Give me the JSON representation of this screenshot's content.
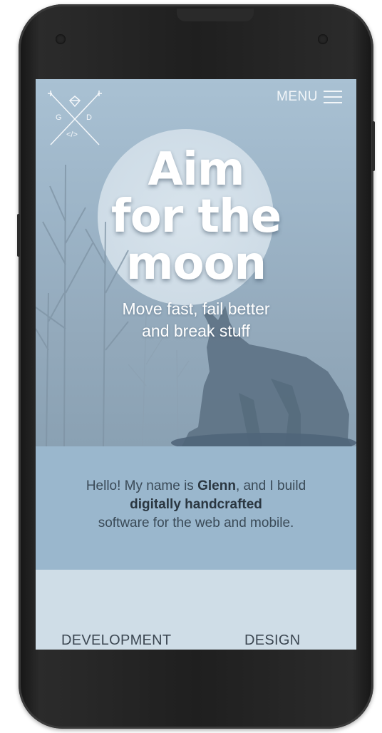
{
  "header": {
    "logo_letters": [
      "G",
      "D",
      "</>"
    ],
    "menu_label": "MENU"
  },
  "hero": {
    "headline_lines": [
      "Aim",
      "for the",
      "moon"
    ],
    "subtitle_lines": [
      "Move fast, fail better",
      "and break stuff"
    ]
  },
  "intro": {
    "pre": "Hello! My name is ",
    "name": "Glenn",
    "mid": ", and I build",
    "highlight": "digitally handcrafted",
    "post": "software for the web and mobile."
  },
  "services": [
    "DEVELOPMENT",
    "DESIGN"
  ],
  "colors": {
    "hero_bg": "#a9c1d3",
    "intro_bg": "#9ab7cd",
    "services_bg": "#cfdde7",
    "phone_body": "#1f1f1f"
  }
}
